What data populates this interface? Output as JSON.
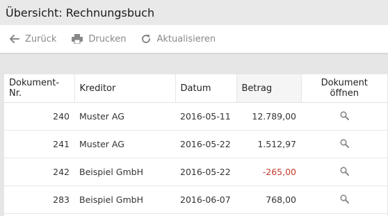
{
  "window": {
    "title": "Übersicht: Rechnungsbuch"
  },
  "toolbar": {
    "back_label": "Zurück",
    "print_label": "Drucken",
    "refresh_label": "Aktualisieren"
  },
  "table": {
    "headers": {
      "doc_nr": "Dokument-Nr.",
      "creditor": "Kreditor",
      "date": "Datum",
      "amount": "Betrag",
      "open_doc": "Dokument öffnen"
    },
    "rows": [
      {
        "doc_nr": "240",
        "creditor": "Muster AG",
        "date": "2016-05-11",
        "amount": "12.789,00",
        "negative": false
      },
      {
        "doc_nr": "241",
        "creditor": "Muster AG",
        "date": "2016-05-22",
        "amount": "1.512,97",
        "negative": false
      },
      {
        "doc_nr": "242",
        "creditor": "Beispiel GmbH",
        "date": "2016-05-22",
        "amount": "-265,00",
        "negative": true
      },
      {
        "doc_nr": "283",
        "creditor": "Beispiel GmbH",
        "date": "2016-06-07",
        "amount": "768,00",
        "negative": false
      }
    ]
  },
  "icons": {
    "back": "arrow-left-icon",
    "print": "printer-icon",
    "refresh": "refresh-icon",
    "open": "search-icon"
  },
  "colors": {
    "negative_amount": "#c0392b"
  }
}
